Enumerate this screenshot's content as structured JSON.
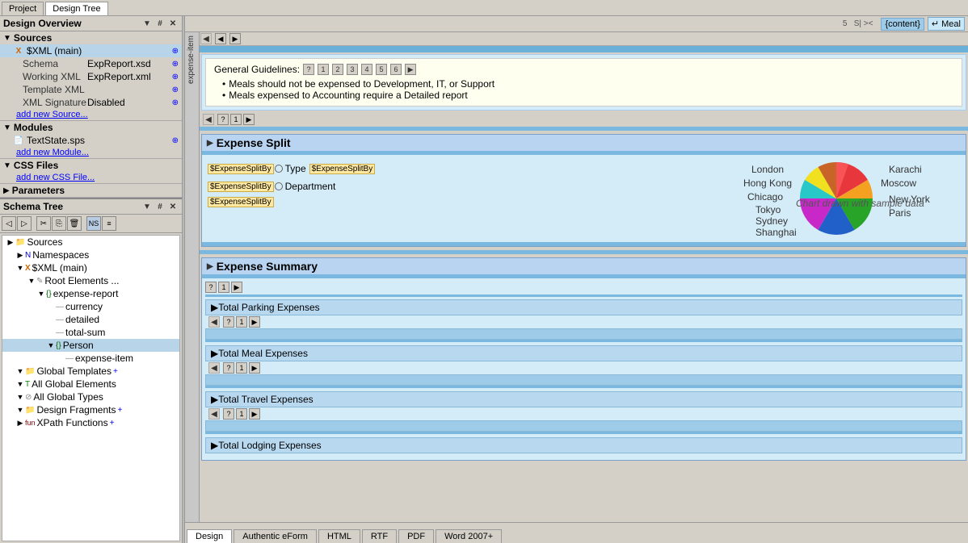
{
  "tabs": {
    "project": "Project",
    "design_tree": "Design Tree"
  },
  "design_overview": {
    "title": "Design Overview",
    "collapse_icon": "▼",
    "pin_icon": "▲",
    "close_icon": "✕"
  },
  "sources": {
    "label": "Sources",
    "xml_main": "$XML (main)",
    "schema_label": "Schema",
    "schema_value": "ExpReport.xsd",
    "working_xml_label": "Working XML",
    "working_xml_value": "ExpReport.xml",
    "template_xml_label": "Template XML",
    "template_xml_value": "",
    "xml_signature_label": "XML Signature",
    "xml_signature_value": "Disabled",
    "add_source": "add new Source..."
  },
  "modules": {
    "label": "Modules",
    "textstate": "TextState.sps",
    "add_module": "add new Module..."
  },
  "css_files": {
    "label": "CSS Files",
    "add_css": "add new CSS File..."
  },
  "parameters": {
    "label": "Parameters"
  },
  "schema_tree": {
    "title": "Schema Tree",
    "sources_label": "Sources",
    "namespaces_label": "Namespaces",
    "xml_main_label": "$XML (main)",
    "root_elements_label": "Root Elements ...",
    "expense_report_label": "expense-report",
    "currency_label": "currency",
    "detailed_label": "detailed",
    "total_sum_label": "total-sum",
    "person_label": "Person",
    "expense_item_label": "expense-item",
    "global_templates_label": "Global Templates",
    "all_global_elements_label": "All Global Elements",
    "all_global_types_label": "All Global Types",
    "design_fragments_label": "Design Fragments",
    "xpath_functions_label": "XPath Functions"
  },
  "main_content": {
    "vtab_label": "expense-item",
    "guidelines": {
      "label": "General Guidelines:",
      "nums": [
        "?",
        "1",
        "2",
        "3",
        "4",
        "5",
        "6",
        "▶"
      ],
      "bullet1": "Meals should not be expensed to Development, IT, or Support",
      "bullet2": "Meals expensed to Accounting require a Detailed report"
    },
    "expense_split": {
      "title": "Expense Split",
      "field1": "$ExpenseSplitBy",
      "type_label": "Type",
      "field2": "$ExpenseSplitBy",
      "dept_label": "Department",
      "field3": "$ExpenseSplitBy",
      "chart_text": "Chart drawn with sample data"
    },
    "pie_chart": {
      "labels": [
        "London",
        "Karachi",
        "Hong Kong",
        "Moscow",
        "Chicago",
        "New York",
        "Tokyo",
        "Paris",
        "Sydney",
        "Shanghai"
      ],
      "colors": [
        "#e8373c",
        "#f4a020",
        "#28a428",
        "#2060c8",
        "#c828c8",
        "#28c8c8",
        "#f0e020",
        "#c86428",
        "#60c060",
        "#c83060"
      ]
    },
    "expense_summary": {
      "title": "Expense Summary",
      "sections": [
        {
          "label": "Total Parking Expenses"
        },
        {
          "label": "Total Meal Expenses"
        },
        {
          "label": "Total Travel Expenses"
        },
        {
          "label": "Total Lodging Expenses"
        }
      ]
    }
  },
  "top_right_bar": {
    "content_label": "{content}",
    "meal_label": "↵ Meal"
  },
  "bottom_tabs": {
    "design": "Design",
    "authentic": "Authentic eForm",
    "html": "HTML",
    "rtf": "RTF",
    "pdf": "PDF",
    "word": "Word 2007+"
  }
}
